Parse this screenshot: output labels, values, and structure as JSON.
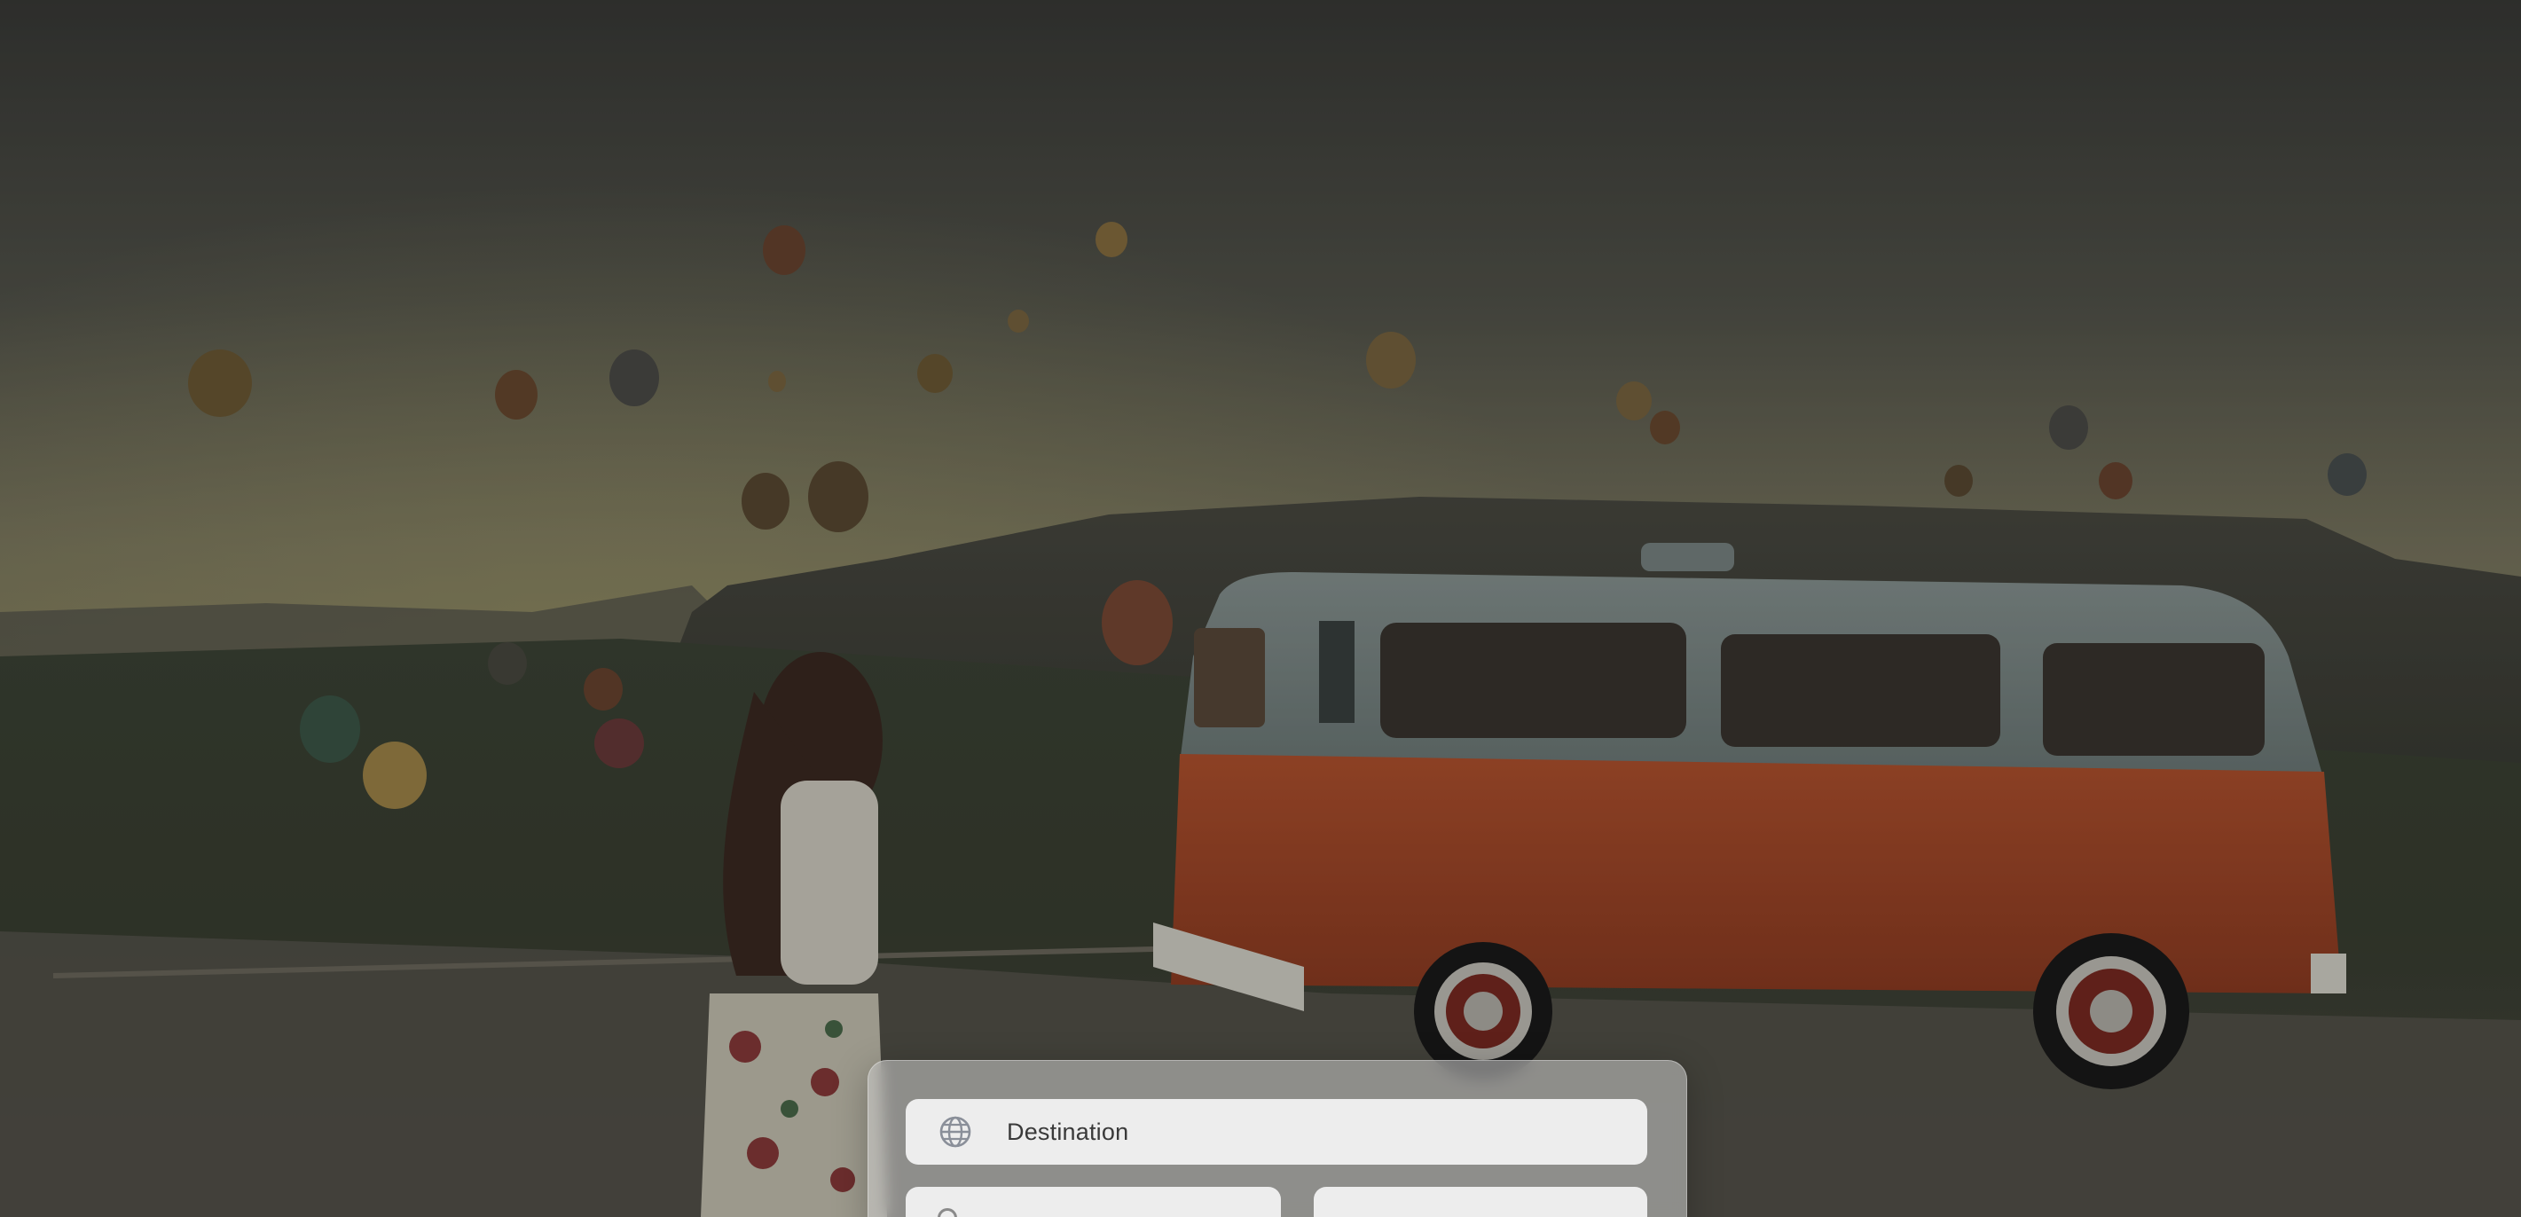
{
  "hero": {
    "image_description_icon": "travel-hero-photo"
  },
  "search": {
    "destination_placeholder": "Destination",
    "destination_icon": "globe-icon"
  }
}
